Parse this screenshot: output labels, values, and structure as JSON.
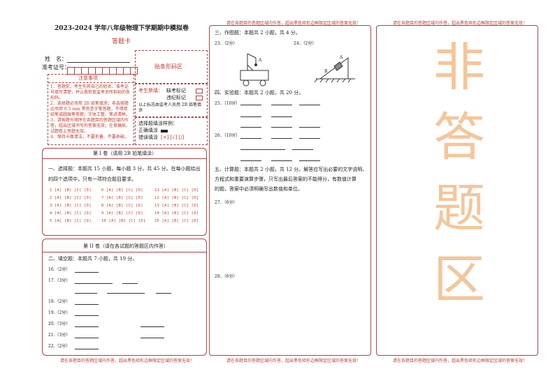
{
  "header": {
    "title": "2023-2024 学年八年级物理下学期期中模拟卷",
    "subtitle": "答题卡",
    "name_label": "姓　名：",
    "id_label": "准考证号："
  },
  "barcode": {
    "label": "贴条形码区"
  },
  "notes": {
    "title": "注意事项",
    "items": [
      "1．答题前，考生先将自己的姓名、准考证号填写清楚，并认真检查监考员所粘贴的条形码。",
      "2．选择题必须用 2B 铅笔填涂；非选择题必须用 0.5 mm 黑色签字笔答题，不得用铅笔或圆珠笔答题；字体工整、笔迹清晰。",
      "3．请按题号顺序在各题目的答题区域内作答，超出区域书写的答案无效；在草稿纸、试题卷上答题无效。",
      "4．保持卡面清洁，不要折叠、不要弄破。"
    ]
  },
  "exam_status": {
    "label": "考生禁填：",
    "absent": "缺考标记",
    "violation": "违纪标记",
    "note": "以上标志由监考人员用 2B 铅笔填涂"
  },
  "fill_sample": {
    "title": "选择题填涂样例：",
    "correct": "正确填涂",
    "wrong": "错误填涂",
    "wrong_marks": "[×] [√] [/]"
  },
  "part1": {
    "title": "第 I 卷（请用 2B 铅笔填涂）",
    "instruction_l1": "一、选择题：本题共 15 小题，每小题 3 分，共 45 分。在每小题给出",
    "instruction_l2": "的四个选项中，只有一项符合题目要求。",
    "col1": [
      "1",
      "2",
      "3",
      "4",
      "5"
    ],
    "col2": [
      "6",
      "7",
      "8",
      "9",
      "10"
    ],
    "col3": [
      "11",
      "12",
      "13",
      "14",
      "15"
    ],
    "options": "[A] [B] [C] [D]"
  },
  "part2": {
    "title": "第 II 卷（请在各试题的答题区内作答）",
    "section_title": "二、填空题：本题共 7 小题，共 19 分。",
    "questions": [
      {
        "num": "16.",
        "pts": "（2分）"
      },
      {
        "num": "17.",
        "pts": "（3分）"
      },
      {
        "num": "18.",
        "pts": "（2分）"
      },
      {
        "num": "19.",
        "pts": "（2分）"
      },
      {
        "num": "20.",
        "pts": "（3分）"
      },
      {
        "num": "21.",
        "pts": "（3分）"
      },
      {
        "num": "22.",
        "pts": "（2分）"
      }
    ]
  },
  "notice_text": "请在各题目的答题区域内作答，超出黑色矩形边框限定区域的答案无效！",
  "middle": {
    "section3": "三、作图题：本题共 2 小题，共 4 分。",
    "q23": "23．（2分）",
    "q24": "24．（2分）",
    "label_a1": "A",
    "label_a2": "A",
    "label_b": "B",
    "section4": "四、实验题：本题共 2 小题，共 20 分。",
    "q25": "25．（10分）",
    "q26": "26．（10分）",
    "section5_l1": "五、计算题：本题共 2 小题，共 12 分。解答应写出必要的文字说明、",
    "section5_l2": "方程式和重要演算步骤，只写出最后答案的不能得分，有数值计算",
    "section5_l3": "的题，答案中必须明确写出数值和单位。",
    "q27": "27．（6分）",
    "q28": "28．（6分）"
  },
  "right": {
    "chars": [
      "非",
      "答",
      "题",
      "区"
    ]
  }
}
